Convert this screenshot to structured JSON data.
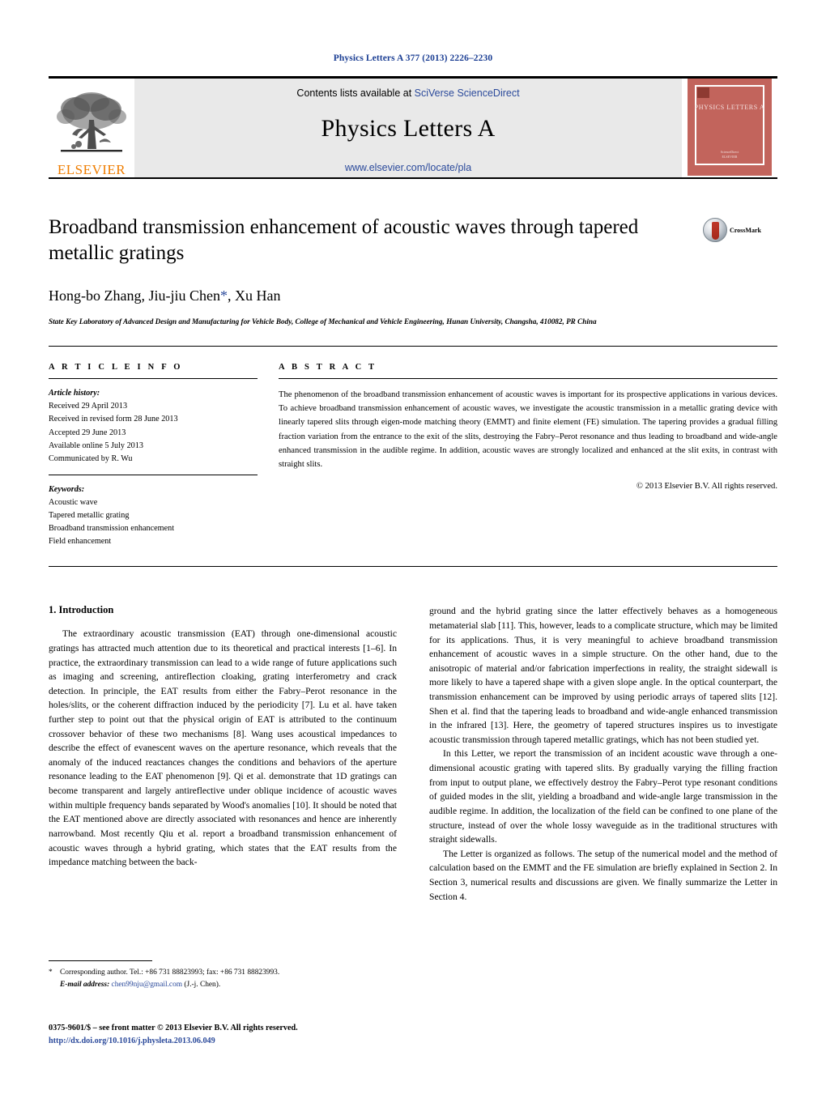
{
  "running_head": "Physics Letters A 377 (2013) 2226–2230",
  "masthead": {
    "elsevier_wordmark": "ELSEVIER",
    "contents_prefix": "Contents lists available at ",
    "contents_link": "SciVerse ScienceDirect",
    "journal_title": "Physics Letters A",
    "journal_url": "www.elsevier.com/locate/pla",
    "cover_title": "PHYSICS LETTERS A",
    "cover_footer": "ScienceDirect\nPHYSICS LETTERS"
  },
  "article": {
    "title": "Broadband transmission enhancement of acoustic waves through tapered metallic gratings",
    "authors_pre": "Hong-bo Zhang, Jiu-jiu Chen",
    "authors_star": "*",
    "authors_post": ", Xu Han",
    "affiliation": "State Key Laboratory of Advanced Design and Manufacturing for Vehicle Body, College of Mechanical and Vehicle Engineering, Hunan University, Changsha, 410082, PR China",
    "crossmark_label": "CrossMark"
  },
  "info": {
    "heading": "A R T I C L E    I N F O",
    "history_label": "Article history:",
    "history": [
      "Received 29 April 2013",
      "Received in revised form 28 June 2013",
      "Accepted 29 June 2013",
      "Available online 5 July 2013",
      "Communicated by R. Wu"
    ],
    "keywords_label": "Keywords:",
    "keywords": [
      "Acoustic wave",
      "Tapered metallic grating",
      "Broadband transmission enhancement",
      "Field enhancement"
    ]
  },
  "abstract": {
    "heading": "A B S T R A C T",
    "text": "The phenomenon of the broadband transmission enhancement of acoustic waves is important for its prospective applications in various devices. To achieve broadband transmission enhancement of acoustic waves, we investigate the acoustic transmission in a metallic grating device with linearly tapered slits through eigen-mode matching theory (EMMT) and finite element (FE) simulation. The tapering provides a gradual filling fraction variation from the entrance to the exit of the slits, destroying the Fabry–Perot resonance and thus leading to broadband and wide-angle enhanced transmission in the audible regime. In addition, acoustic waves are strongly localized and enhanced at the slit exits, in contrast with straight slits.",
    "copyright": "© 2013 Elsevier B.V. All rights reserved."
  },
  "body": {
    "section_heading": "1. Introduction",
    "left_paragraphs": [
      "The extraordinary acoustic transmission (EAT) through one-dimensional acoustic gratings has attracted much attention due to its theoretical and practical interests [1–6]. In practice, the extraordinary transmission can lead to a wide range of future applications such as imaging and screening, antireflection cloaking, grating interferometry and crack detection. In principle, the EAT results from either the Fabry–Perot resonance in the holes/slits, or the coherent diffraction induced by the periodicity [7]. Lu et al. have taken further step to point out that the physical origin of EAT is attributed to the continuum crossover behavior of these two mechanisms [8]. Wang uses acoustical impedances to describe the effect of evanescent waves on the aperture resonance, which reveals that the anomaly of the induced reactances changes the conditions and behaviors of the aperture resonance leading to the EAT phenomenon [9]. Qi et al. demonstrate that 1D gratings can become transparent and largely antireflective under oblique incidence of acoustic waves within multiple frequency bands separated by Wood's anomalies [10]. It should be noted that the EAT mentioned above are directly associated with resonances and hence are inherently narrowband. Most recently Qiu et al. report a broadband transmission enhancement of acoustic waves through a hybrid grating, which states that the EAT results from the impedance matching between the back-"
    ],
    "right_paragraphs": [
      "ground and the hybrid grating since the latter effectively behaves as a homogeneous metamaterial slab [11]. This, however, leads to a complicate structure, which may be limited for its applications. Thus, it is very meaningful to achieve broadband transmission enhancement of acoustic waves in a simple structure. On the other hand, due to the anisotropic of material and/or fabrication imperfections in reality, the straight sidewall is more likely to have a tapered shape with a given slope angle. In the optical counterpart, the transmission enhancement can be improved by using periodic arrays of tapered slits [12]. Shen et al. find that the tapering leads to broadband and wide-angle enhanced transmission in the infrared [13]. Here, the geometry of tapered structures inspires us to investigate acoustic transmission through tapered metallic gratings, which has not been studied yet.",
      "In this Letter, we report the transmission of an incident acoustic wave through a one-dimensional acoustic grating with tapered slits. By gradually varying the filling fraction from input to output plane, we effectively destroy the Fabry–Perot type resonant conditions of guided modes in the slit, yielding a broadband and wide-angle large transmission in the audible regime. In addition, the localization of the field can be confined to one plane of the structure, instead of over the whole lossy waveguide as in the traditional structures with straight sidewalls.",
      "The Letter is organized as follows. The setup of the numerical model and the method of calculation based on the EMMT and the FE simulation are briefly explained in Section 2. In Section 3, numerical results and discussions are given. We finally summarize the Letter in Section 4."
    ]
  },
  "footnote": {
    "star": "*",
    "corresponding": "Corresponding author. Tel.: +86 731 88823993; fax: +86 731 88823993.",
    "email_label": "E-mail address:",
    "email": "chen99nju@gmail.com",
    "email_owner": "(J.-j. Chen)."
  },
  "footer": {
    "issn_line": "0375-9601/$ – see front matter  © 2013 Elsevier B.V. All rights reserved.",
    "doi": "http://dx.doi.org/10.1016/j.physleta.2013.06.049"
  },
  "colors": {
    "link": "#2b4a9b",
    "elsevier_orange": "#ef7d00",
    "cover_red": "#c2645c",
    "banner_gray": "#e9e9e9"
  }
}
